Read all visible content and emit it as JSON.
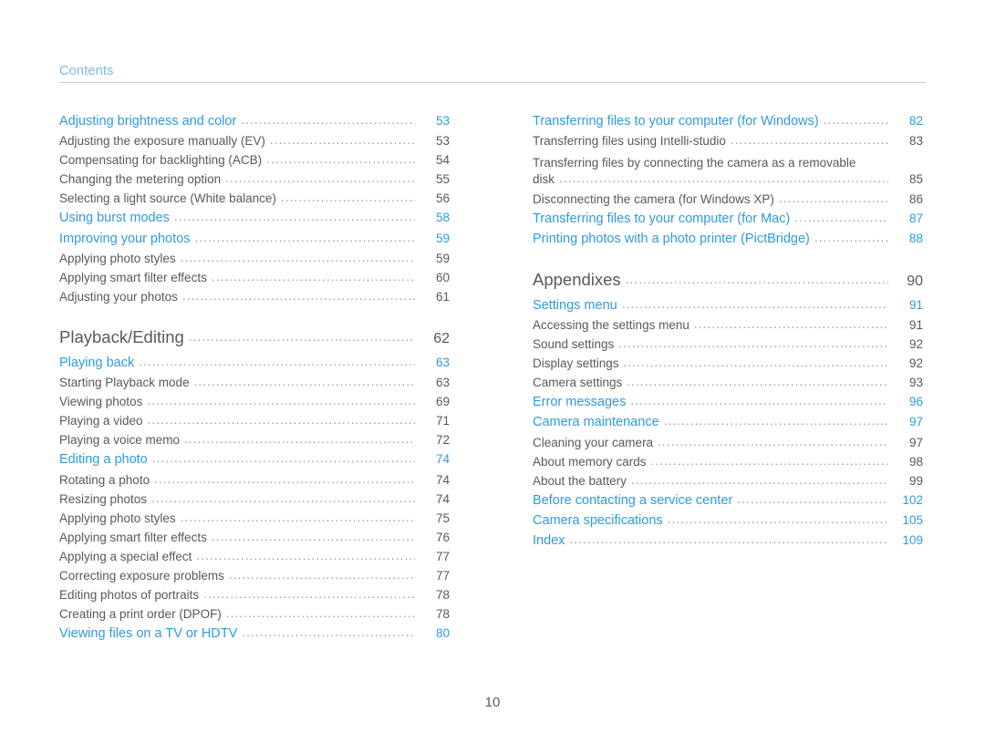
{
  "header": {
    "label": "Contents"
  },
  "page_number": "10",
  "left_column": [
    {
      "type": "entry",
      "level": "blue",
      "title": "Adjusting brightness and color",
      "page": "53"
    },
    {
      "type": "entry",
      "level": "plain",
      "title": "Adjusting the exposure manually (EV)",
      "page": "53"
    },
    {
      "type": "entry",
      "level": "plain",
      "title": "Compensating for backlighting (ACB)",
      "page": "54"
    },
    {
      "type": "entry",
      "level": "plain",
      "title": "Changing the metering option",
      "page": "55"
    },
    {
      "type": "entry",
      "level": "plain",
      "title": "Selecting a light source (White balance)",
      "page": "56"
    },
    {
      "type": "entry",
      "level": "blue",
      "title": "Using burst modes",
      "page": "58"
    },
    {
      "type": "entry",
      "level": "blue",
      "title": "Improving your photos",
      "page": "59"
    },
    {
      "type": "entry",
      "level": "plain",
      "title": "Applying photo styles",
      "page": "59"
    },
    {
      "type": "entry",
      "level": "plain",
      "title": "Applying smart filter effects",
      "page": "60"
    },
    {
      "type": "entry",
      "level": "plain",
      "title": "Adjusting your photos",
      "page": "61"
    },
    {
      "type": "spacer",
      "size": "chapter"
    },
    {
      "type": "entry",
      "level": "chapter",
      "title": "Playback/Editing",
      "page": "62"
    },
    {
      "type": "entry",
      "level": "blue",
      "title": "Playing back",
      "page": "63"
    },
    {
      "type": "entry",
      "level": "plain",
      "title": "Starting Playback mode",
      "page": "63"
    },
    {
      "type": "entry",
      "level": "plain",
      "title": "Viewing photos",
      "page": "69"
    },
    {
      "type": "entry",
      "level": "plain",
      "title": "Playing a video",
      "page": "71"
    },
    {
      "type": "entry",
      "level": "plain",
      "title": "Playing a voice memo",
      "page": "72"
    },
    {
      "type": "entry",
      "level": "blue",
      "title": "Editing a photo",
      "page": "74"
    },
    {
      "type": "entry",
      "level": "plain",
      "title": "Rotating a photo",
      "page": "74"
    },
    {
      "type": "entry",
      "level": "plain",
      "title": "Resizing photos",
      "page": "74"
    },
    {
      "type": "entry",
      "level": "plain",
      "title": "Applying photo styles",
      "page": "75"
    },
    {
      "type": "entry",
      "level": "plain",
      "title": "Applying smart filter effects",
      "page": "76"
    },
    {
      "type": "entry",
      "level": "plain",
      "title": "Applying a special effect",
      "page": "77"
    },
    {
      "type": "entry",
      "level": "plain",
      "title": "Correcting exposure problems",
      "page": "77"
    },
    {
      "type": "entry",
      "level": "plain",
      "title": "Editing photos of portraits",
      "page": "78"
    },
    {
      "type": "entry",
      "level": "plain",
      "title": "Creating a print order (DPOF)",
      "page": "78"
    },
    {
      "type": "entry",
      "level": "blue",
      "title": "Viewing files on a TV or HDTV",
      "page": "80"
    }
  ],
  "right_column": [
    {
      "type": "entry",
      "level": "blue",
      "title": "Transferring files to your computer (for Windows)",
      "page": "82"
    },
    {
      "type": "entry",
      "level": "plain",
      "title": "Transferring files using Intelli-studio",
      "page": "83"
    },
    {
      "type": "wrap",
      "text": "Transferring files by connecting the camera as a removable"
    },
    {
      "type": "entry",
      "level": "plain",
      "title": "disk",
      "page": "85"
    },
    {
      "type": "entry",
      "level": "plain",
      "title": "Disconnecting the camera (for Windows XP)",
      "page": "86"
    },
    {
      "type": "entry",
      "level": "blue",
      "title": "Transferring files to your computer (for Mac)",
      "page": "87"
    },
    {
      "type": "entry",
      "level": "blue",
      "title": "Printing photos with a photo printer (PictBridge)",
      "page": "88"
    },
    {
      "type": "spacer",
      "size": "chapter"
    },
    {
      "type": "entry",
      "level": "chapter",
      "title": "Appendixes",
      "page": "90"
    },
    {
      "type": "entry",
      "level": "blue",
      "title": "Settings menu",
      "page": "91"
    },
    {
      "type": "entry",
      "level": "plain",
      "title": "Accessing the settings menu",
      "page": "91"
    },
    {
      "type": "entry",
      "level": "plain",
      "title": "Sound settings",
      "page": "92"
    },
    {
      "type": "entry",
      "level": "plain",
      "title": "Display settings",
      "page": "92"
    },
    {
      "type": "entry",
      "level": "plain",
      "title": "Camera settings",
      "page": "93"
    },
    {
      "type": "entry",
      "level": "blue",
      "title": "Error messages",
      "page": "96"
    },
    {
      "type": "entry",
      "level": "blue",
      "title": "Camera maintenance",
      "page": "97"
    },
    {
      "type": "entry",
      "level": "plain",
      "title": "Cleaning your camera",
      "page": "97"
    },
    {
      "type": "entry",
      "level": "plain",
      "title": "About memory cards",
      "page": "98"
    },
    {
      "type": "entry",
      "level": "plain",
      "title": "About the battery",
      "page": "99"
    },
    {
      "type": "entry",
      "level": "blue",
      "title": "Before contacting a service center",
      "page": "102"
    },
    {
      "type": "entry",
      "level": "blue",
      "title": "Camera specifications",
      "page": "105"
    },
    {
      "type": "entry",
      "level": "blue",
      "title": "Index",
      "page": "109"
    }
  ]
}
